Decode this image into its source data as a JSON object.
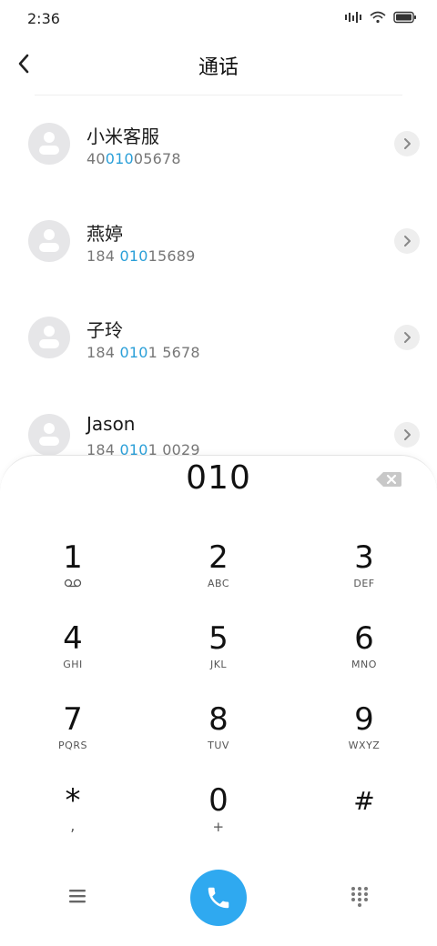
{
  "status_bar": {
    "time": "2:36"
  },
  "header": {
    "title": "通话"
  },
  "contacts": [
    {
      "name": "小米客服",
      "number_pre": "40",
      "number_hl": "010",
      "number_post": "05678"
    },
    {
      "name": "燕婷",
      "number_pre": "184 ",
      "number_hl": "010",
      "number_post": "15689"
    },
    {
      "name": "子玲",
      "number_pre": "184 ",
      "number_hl": "010",
      "number_post": "1 5678"
    },
    {
      "name": "Jason",
      "number_pre": "184 ",
      "number_hl": "010",
      "number_post": "1 0029"
    }
  ],
  "dialer": {
    "input": "010",
    "keys": [
      {
        "digit": "1",
        "letters": ""
      },
      {
        "digit": "2",
        "letters": "ABC"
      },
      {
        "digit": "3",
        "letters": "DEF"
      },
      {
        "digit": "4",
        "letters": "GHI"
      },
      {
        "digit": "5",
        "letters": "JKL"
      },
      {
        "digit": "6",
        "letters": "MNO"
      },
      {
        "digit": "7",
        "letters": "PQRS"
      },
      {
        "digit": "8",
        "letters": "TUV"
      },
      {
        "digit": "9",
        "letters": "WXYZ"
      },
      {
        "digit": "*",
        "letters": ","
      },
      {
        "digit": "0",
        "letters": "+"
      },
      {
        "digit": "#",
        "letters": ""
      }
    ]
  },
  "colors": {
    "accent": "#2fa9f0",
    "highlight": "#2a9fd8",
    "avatar_bg": "#e6e6e8"
  },
  "icons": {
    "key_1_sub": "voicemail-icon",
    "back": "chevron-left-icon",
    "detail": "chevron-right-icon",
    "delete": "backspace-icon",
    "menu": "menu-icon",
    "call": "phone-icon",
    "keypad": "keypad-icon"
  }
}
